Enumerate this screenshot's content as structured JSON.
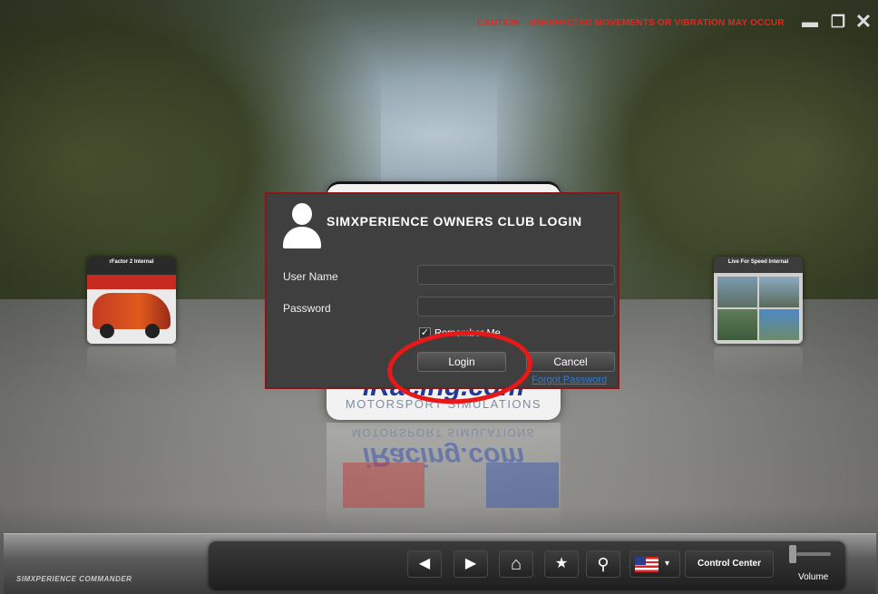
{
  "window": {
    "caution_text": "CAUTION : UNEXPECTED MOVEMENTS OR VIBRATION MAY OCCUR",
    "min_glyph": "▬",
    "max_glyph": "❐",
    "close_glyph": "✕"
  },
  "tiles": {
    "left_title": "rFactor 2 Internal",
    "right_title": "Live For Speed Internal"
  },
  "center_card": {
    "brand": "iRacing.com",
    "subtitle": "MOTORSPORT SIMULATIONS"
  },
  "login_dialog": {
    "title": "SIMXPERIENCE OWNERS CLUB LOGIN",
    "username_label": "User Name",
    "username_value": "",
    "password_label": "Password",
    "password_value": "",
    "remember_label": "Remember Me",
    "remember_checked": true,
    "login_label": "Login",
    "cancel_label": "Cancel",
    "forgot_label": "Forgot Password"
  },
  "bottom_bar": {
    "brand": "SIMXPERIENCE COMMANDER",
    "back_glyph": "◀",
    "forward_glyph": "▶",
    "home_glyph": "⌂",
    "favorite_glyph": "★",
    "search_glyph": "⚲",
    "language_caret": "▾",
    "control_center_label": "Control Center",
    "volume_label": "Volume"
  },
  "colors": {
    "caution": "#e3261f",
    "dialog_border": "#8b1414",
    "annotation": "#e81818",
    "link": "#2f7bd6"
  }
}
